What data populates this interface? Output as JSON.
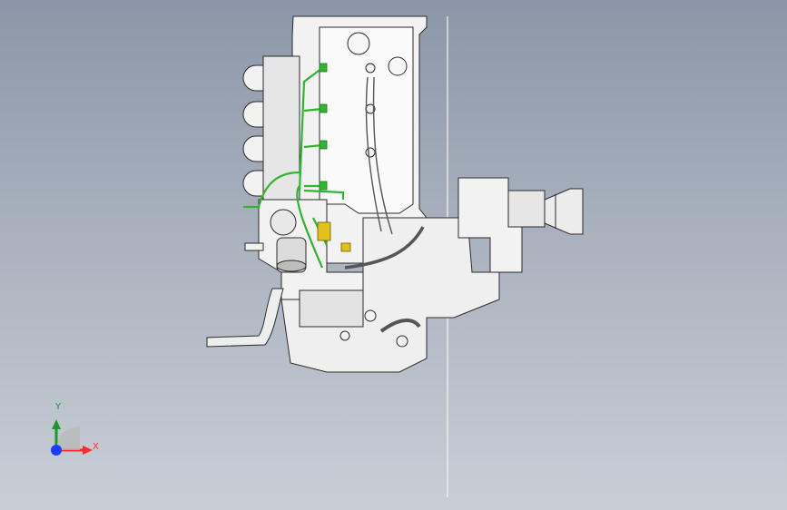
{
  "viewport": {
    "background_top": "#8b96a8",
    "background_bottom": "#c9ced6"
  },
  "model": {
    "outline_color": "#2b2b2b",
    "body_fill": "#f2f2f2",
    "shade_fill": "#d8d8d8",
    "wire_color": "#2fb52f",
    "connector_color": "#e0c21a",
    "hose_color": "#555555"
  },
  "triad": {
    "x_label": "X",
    "y_label": "Y",
    "x_color": "#ff2a2a",
    "y_color": "#1a9a2a",
    "z_color": "#1a3bff"
  }
}
